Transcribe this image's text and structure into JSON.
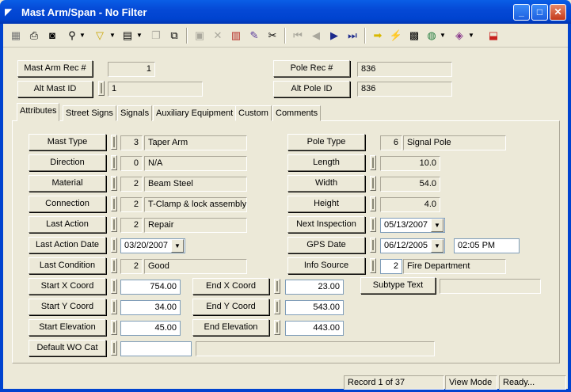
{
  "window": {
    "title": "Mast Arm/Span - No Filter",
    "min_glyph": "_",
    "max_glyph": "□",
    "close_glyph": "✕"
  },
  "header": {
    "mast_arm_rec_label": "Mast Arm Rec #",
    "mast_arm_rec_value": "1",
    "alt_mast_id_label": "Alt Mast ID",
    "alt_mast_id_value": "1",
    "pole_rec_label": "Pole Rec #",
    "pole_rec_value": "836",
    "alt_pole_id_label": "Alt Pole ID",
    "alt_pole_id_value": "836"
  },
  "tabs": [
    {
      "label": "Attributes"
    },
    {
      "label": "Street Signs"
    },
    {
      "label": "Signals"
    },
    {
      "label": "Auxiliary Equipment"
    },
    {
      "label": "Custom"
    },
    {
      "label": "Comments"
    }
  ],
  "attributes": {
    "mast_type": {
      "label": "Mast Type",
      "code": "3",
      "value": "Taper Arm"
    },
    "direction": {
      "label": "Direction",
      "code": "0",
      "value": "N/A"
    },
    "material": {
      "label": "Material",
      "code": "2",
      "value": "Beam Steel"
    },
    "connection": {
      "label": "Connection",
      "code": "2",
      "value": "T-Clamp & lock assembly"
    },
    "last_action": {
      "label": "Last Action",
      "code": "2",
      "value": "Repair"
    },
    "last_action_date": {
      "label": "Last Action Date",
      "value": "03/20/2007"
    },
    "last_condition": {
      "label": "Last Condition",
      "code": "2",
      "value": "Good"
    },
    "start_x": {
      "label": "Start X Coord",
      "value": "754.00"
    },
    "start_y": {
      "label": "Start Y Coord",
      "value": "34.00"
    },
    "start_elev": {
      "label": "Start Elevation",
      "value": "45.00"
    },
    "end_x": {
      "label": "End X Coord",
      "value": "23.00"
    },
    "end_y": {
      "label": "End Y Coord",
      "value": "543.00"
    },
    "end_elev": {
      "label": "End Elevation",
      "value": "443.00"
    },
    "default_wo_cat": {
      "label": "Default WO Cat",
      "value": "",
      "desc": ""
    },
    "pole_type": {
      "label": "Pole Type",
      "code": "6",
      "value": "Signal Pole"
    },
    "length": {
      "label": "Length",
      "value": "10.0"
    },
    "width": {
      "label": "Width",
      "value": "54.0"
    },
    "height": {
      "label": "Height",
      "value": "4.0"
    },
    "next_inspection": {
      "label": "Next Inspection",
      "value": "05/13/2007"
    },
    "gps_date": {
      "label": "GPS Date",
      "value": "06/12/2005",
      "time": "02:05 PM"
    },
    "info_source": {
      "label": "Info Source",
      "code": "2",
      "value": "Fire Department"
    },
    "subtype_text": {
      "label": "Subtype Text",
      "value": ""
    }
  },
  "status_bar": {
    "record": "Record 1 of 37",
    "mode": "View Mode",
    "state": "Ready..."
  },
  "toolbar_icons": [
    "grid-icon",
    "print-icon",
    "preview-icon",
    "binoculars-icon",
    "filter-icon",
    "report-icon",
    "copy-icon",
    "paste-icon",
    "save-icon",
    "delete-icon",
    "books-icon",
    "edit-icon",
    "cut-icon",
    "first-record-icon",
    "previous-record-icon",
    "next-record-icon",
    "last-record-icon",
    "arrow-right-icon",
    "lightning-icon",
    "map-icon",
    "globe-icon",
    "library-icon",
    "exit-icon"
  ]
}
